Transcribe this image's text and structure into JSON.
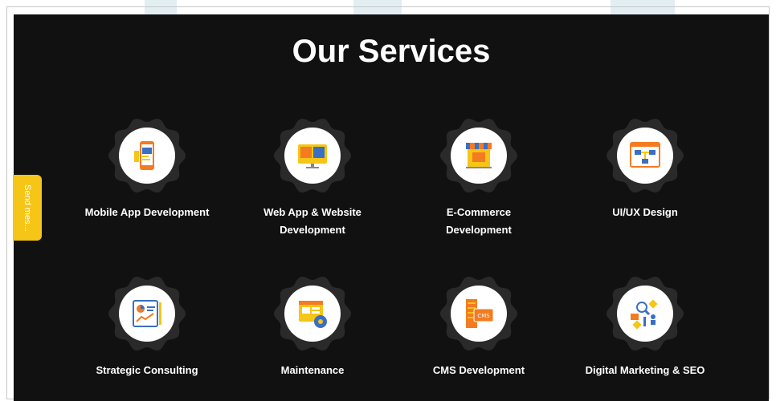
{
  "page": {
    "title": "Our Services"
  },
  "feedback_tab": {
    "label": "Send mes..."
  },
  "services": [
    {
      "label_line1": "Mobile App Development",
      "label_line2": "",
      "icon": "mobile-app-icon"
    },
    {
      "label_line1": "Web App & Website",
      "label_line2": "Development",
      "icon": "web-app-icon"
    },
    {
      "label_line1": "E-Commerce",
      "label_line2": "Development",
      "icon": "ecommerce-store-icon"
    },
    {
      "label_line1": "UI/UX Design",
      "label_line2": "",
      "icon": "ui-ux-flow-icon"
    },
    {
      "label_line1": "Strategic Consulting",
      "label_line2": "",
      "icon": "consulting-chart-icon"
    },
    {
      "label_line1": "Maintenance",
      "label_line2": "",
      "icon": "maintenance-gear-icon"
    },
    {
      "label_line1": "CMS Development",
      "label_line2": "",
      "icon": "cms-server-icon"
    },
    {
      "label_line1": "Digital Marketing & SEO",
      "label_line2": "",
      "icon": "digital-marketing-icon"
    }
  ],
  "colors": {
    "panel_background": "#111111",
    "badge_background": "#2a2a2a",
    "feedback_tab": "#f5c518",
    "icon_orange": "#f47b20",
    "icon_blue": "#3a6fc4",
    "icon_yellow": "#f5c518"
  }
}
